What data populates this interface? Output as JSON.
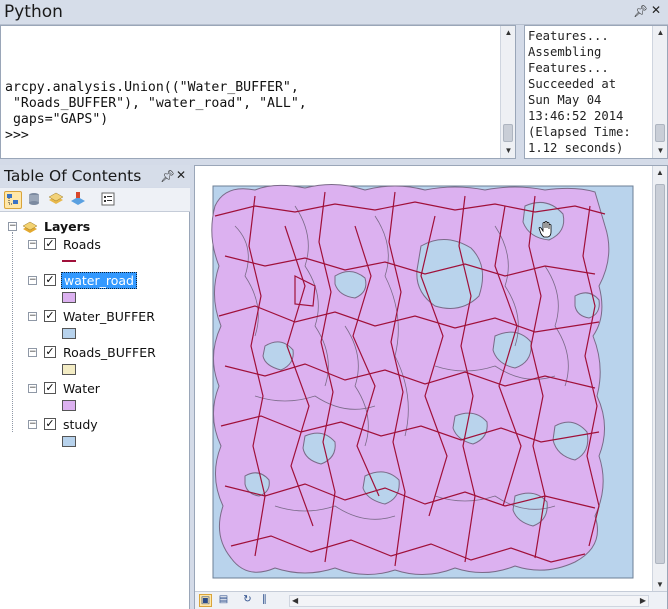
{
  "python_window": {
    "title": "Python",
    "input_text": "arcpy.analysis.Union((\"Water_BUFFER\",\n \"Roads_BUFFER\"), \"water_road\", \"ALL\",\n gaps=\"GAPS\")\n>>>",
    "output_text": "Features...\nAssembling\nFeatures...\nSucceeded at\nSun May 04\n13:46:52 2014\n(Elapsed Time:\n1.12 seconds)"
  },
  "toc": {
    "title": "Table Of Contents",
    "root_label": "Layers",
    "layers": [
      {
        "name": "Roads",
        "checked": true,
        "symbol": "line",
        "color": "#a0103a"
      },
      {
        "name": "water_road",
        "checked": true,
        "symbol": "fill",
        "color": "#dcb1f0",
        "selected": true
      },
      {
        "name": "Water_BUFFER",
        "checked": true,
        "symbol": "fill",
        "color": "#b7d2ec"
      },
      {
        "name": "Roads_BUFFER",
        "checked": true,
        "symbol": "fill",
        "color": "#f3ecc4"
      },
      {
        "name": "Water",
        "checked": true,
        "symbol": "fill",
        "color": "#dcb1f0"
      },
      {
        "name": "study",
        "checked": true,
        "symbol": "fill",
        "color": "#b7d2ec"
      }
    ]
  },
  "icons": {
    "pin": "pin-icon",
    "close": "close-icon",
    "cursor": "hand-cursor-icon"
  },
  "map": {
    "study_color": "#b9d3ec",
    "union_color": "#dcb1f0",
    "road_color": "#a0103a"
  }
}
